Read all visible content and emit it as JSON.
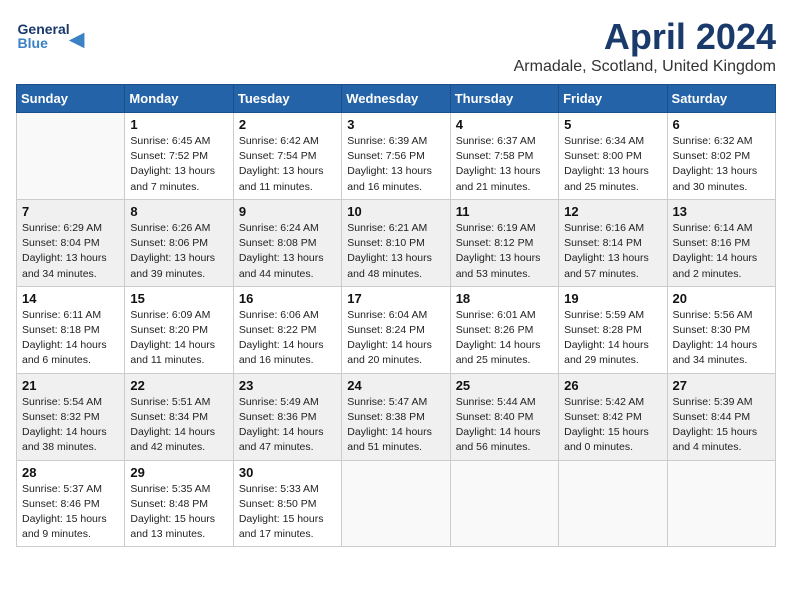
{
  "header": {
    "logo_line1": "General",
    "logo_line2": "Blue",
    "title": "April 2024",
    "subtitle": "Armadale, Scotland, United Kingdom"
  },
  "days_of_week": [
    "Sunday",
    "Monday",
    "Tuesday",
    "Wednesday",
    "Thursday",
    "Friday",
    "Saturday"
  ],
  "weeks": [
    [
      {
        "day": "",
        "info": ""
      },
      {
        "day": "1",
        "info": "Sunrise: 6:45 AM\nSunset: 7:52 PM\nDaylight: 13 hours\nand 7 minutes."
      },
      {
        "day": "2",
        "info": "Sunrise: 6:42 AM\nSunset: 7:54 PM\nDaylight: 13 hours\nand 11 minutes."
      },
      {
        "day": "3",
        "info": "Sunrise: 6:39 AM\nSunset: 7:56 PM\nDaylight: 13 hours\nand 16 minutes."
      },
      {
        "day": "4",
        "info": "Sunrise: 6:37 AM\nSunset: 7:58 PM\nDaylight: 13 hours\nand 21 minutes."
      },
      {
        "day": "5",
        "info": "Sunrise: 6:34 AM\nSunset: 8:00 PM\nDaylight: 13 hours\nand 25 minutes."
      },
      {
        "day": "6",
        "info": "Sunrise: 6:32 AM\nSunset: 8:02 PM\nDaylight: 13 hours\nand 30 minutes."
      }
    ],
    [
      {
        "day": "7",
        "info": "Sunrise: 6:29 AM\nSunset: 8:04 PM\nDaylight: 13 hours\nand 34 minutes."
      },
      {
        "day": "8",
        "info": "Sunrise: 6:26 AM\nSunset: 8:06 PM\nDaylight: 13 hours\nand 39 minutes."
      },
      {
        "day": "9",
        "info": "Sunrise: 6:24 AM\nSunset: 8:08 PM\nDaylight: 13 hours\nand 44 minutes."
      },
      {
        "day": "10",
        "info": "Sunrise: 6:21 AM\nSunset: 8:10 PM\nDaylight: 13 hours\nand 48 minutes."
      },
      {
        "day": "11",
        "info": "Sunrise: 6:19 AM\nSunset: 8:12 PM\nDaylight: 13 hours\nand 53 minutes."
      },
      {
        "day": "12",
        "info": "Sunrise: 6:16 AM\nSunset: 8:14 PM\nDaylight: 13 hours\nand 57 minutes."
      },
      {
        "day": "13",
        "info": "Sunrise: 6:14 AM\nSunset: 8:16 PM\nDaylight: 14 hours\nand 2 minutes."
      }
    ],
    [
      {
        "day": "14",
        "info": "Sunrise: 6:11 AM\nSunset: 8:18 PM\nDaylight: 14 hours\nand 6 minutes."
      },
      {
        "day": "15",
        "info": "Sunrise: 6:09 AM\nSunset: 8:20 PM\nDaylight: 14 hours\nand 11 minutes."
      },
      {
        "day": "16",
        "info": "Sunrise: 6:06 AM\nSunset: 8:22 PM\nDaylight: 14 hours\nand 16 minutes."
      },
      {
        "day": "17",
        "info": "Sunrise: 6:04 AM\nSunset: 8:24 PM\nDaylight: 14 hours\nand 20 minutes."
      },
      {
        "day": "18",
        "info": "Sunrise: 6:01 AM\nSunset: 8:26 PM\nDaylight: 14 hours\nand 25 minutes."
      },
      {
        "day": "19",
        "info": "Sunrise: 5:59 AM\nSunset: 8:28 PM\nDaylight: 14 hours\nand 29 minutes."
      },
      {
        "day": "20",
        "info": "Sunrise: 5:56 AM\nSunset: 8:30 PM\nDaylight: 14 hours\nand 34 minutes."
      }
    ],
    [
      {
        "day": "21",
        "info": "Sunrise: 5:54 AM\nSunset: 8:32 PM\nDaylight: 14 hours\nand 38 minutes."
      },
      {
        "day": "22",
        "info": "Sunrise: 5:51 AM\nSunset: 8:34 PM\nDaylight: 14 hours\nand 42 minutes."
      },
      {
        "day": "23",
        "info": "Sunrise: 5:49 AM\nSunset: 8:36 PM\nDaylight: 14 hours\nand 47 minutes."
      },
      {
        "day": "24",
        "info": "Sunrise: 5:47 AM\nSunset: 8:38 PM\nDaylight: 14 hours\nand 51 minutes."
      },
      {
        "day": "25",
        "info": "Sunrise: 5:44 AM\nSunset: 8:40 PM\nDaylight: 14 hours\nand 56 minutes."
      },
      {
        "day": "26",
        "info": "Sunrise: 5:42 AM\nSunset: 8:42 PM\nDaylight: 15 hours\nand 0 minutes."
      },
      {
        "day": "27",
        "info": "Sunrise: 5:39 AM\nSunset: 8:44 PM\nDaylight: 15 hours\nand 4 minutes."
      }
    ],
    [
      {
        "day": "28",
        "info": "Sunrise: 5:37 AM\nSunset: 8:46 PM\nDaylight: 15 hours\nand 9 minutes."
      },
      {
        "day": "29",
        "info": "Sunrise: 5:35 AM\nSunset: 8:48 PM\nDaylight: 15 hours\nand 13 minutes."
      },
      {
        "day": "30",
        "info": "Sunrise: 5:33 AM\nSunset: 8:50 PM\nDaylight: 15 hours\nand 17 minutes."
      },
      {
        "day": "",
        "info": ""
      },
      {
        "day": "",
        "info": ""
      },
      {
        "day": "",
        "info": ""
      },
      {
        "day": "",
        "info": ""
      }
    ]
  ]
}
